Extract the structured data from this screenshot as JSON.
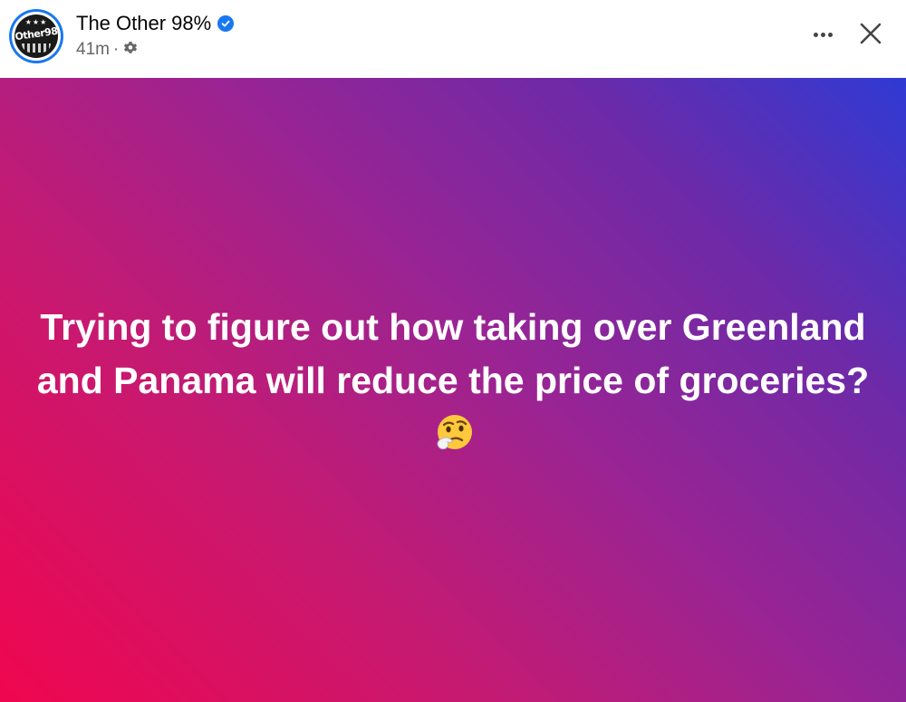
{
  "post": {
    "author": "The Other 98%",
    "avatar_text": "Other98",
    "timestamp": "41m",
    "separator": "·",
    "text": "Trying to figure out how taking over Greenland and Panama will reduce the price of groceries?",
    "emoji": "thinking-face",
    "background": {
      "from": "#f0064f",
      "to": "#2f3ad4"
    }
  },
  "icons": {
    "verified": "verified-badge-icon",
    "audience": "gear-icon",
    "more": "more-options-icon",
    "close": "close-icon"
  },
  "colors": {
    "verified": "#1877f2",
    "author_text": "#050505",
    "meta_text": "#65676b"
  }
}
